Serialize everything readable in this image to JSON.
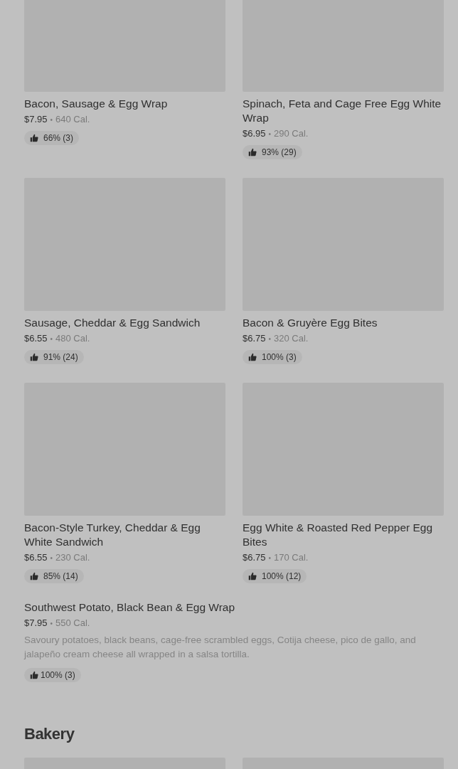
{
  "items": [
    {
      "name": "Bacon, Sausage & Egg Wrap",
      "price": "$7.95",
      "separator": "•",
      "calories": "640 Cal.",
      "rating": "66% (3)"
    },
    {
      "name": "Spinach, Feta and Cage Free Egg White Wrap",
      "price": "$6.95",
      "separator": "•",
      "calories": "290 Cal.",
      "rating": "93% (29)"
    },
    {
      "name": "Sausage, Cheddar & Egg Sandwich",
      "price": "$6.55",
      "separator": "•",
      "calories": "480 Cal.",
      "rating": "91% (24)"
    },
    {
      "name": "Bacon & Gruyère Egg Bites",
      "price": "$6.75",
      "separator": "•",
      "calories": "320 Cal.",
      "rating": "100% (3)"
    },
    {
      "name": "Bacon-Style Turkey, Cheddar & Egg White Sandwich",
      "price": "$6.55",
      "separator": "•",
      "calories": "230 Cal.",
      "rating": "85% (14)"
    },
    {
      "name": "Egg White & Roasted Red Pepper Egg Bites",
      "price": "$6.75",
      "separator": "•",
      "calories": "170 Cal.",
      "rating": "100% (12)"
    }
  ],
  "featured": {
    "name": "Southwest Potato, Black Bean & Egg Wrap",
    "price": "$7.95",
    "separator": "•",
    "calories": "550 Cal.",
    "description": "Savoury potatoes, black beans, cage-free scrambled eggs, Cotija cheese, pico de gallo, and jalapeño cream cheese all wrapped in a salsa tortilla.",
    "rating": "100% (3)"
  },
  "bakery": {
    "heading": "Bakery",
    "items": [
      {
        "kind": "placeholder"
      },
      {
        "kind": "placeholder"
      }
    ]
  }
}
